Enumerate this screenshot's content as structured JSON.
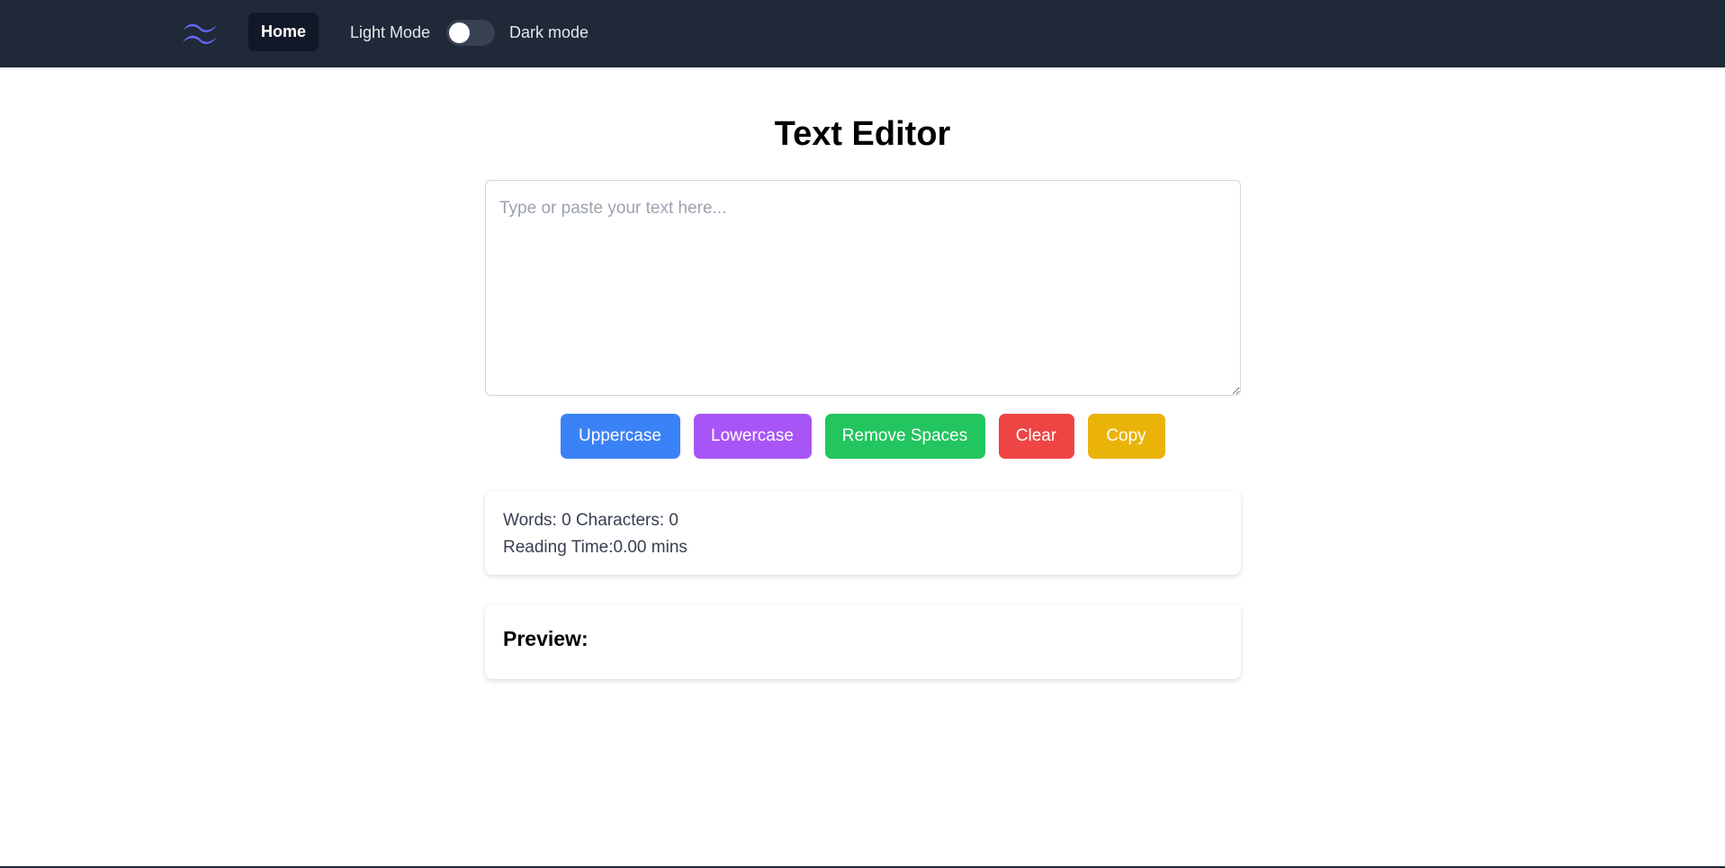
{
  "navbar": {
    "logo_icon": "tailwind-waves-icon",
    "home_label": "Home",
    "light_mode_label": "Light Mode",
    "dark_mode_label": "Dark mode",
    "dark_mode_enabled": false
  },
  "main": {
    "title": "Text Editor",
    "editor_placeholder": "Type or paste your text here...",
    "editor_value": "",
    "buttons": {
      "uppercase": "Uppercase",
      "lowercase": "Lowercase",
      "remove_spaces": "Remove Spaces",
      "clear": "Clear",
      "copy": "Copy"
    },
    "stats": {
      "line1": "Words: 0 Characters: 0",
      "line2": "Reading Time:0.00 mins"
    },
    "preview": {
      "title": "Preview:",
      "content": ""
    }
  },
  "colors": {
    "navbar_bg": "#1f2937",
    "uppercase_button": "#3b82f6",
    "lowercase_button": "#a855f7",
    "remove_spaces_button": "#22c55e",
    "clear_button": "#ef4444",
    "copy_button": "#eab308",
    "logo": "#6366f1"
  }
}
